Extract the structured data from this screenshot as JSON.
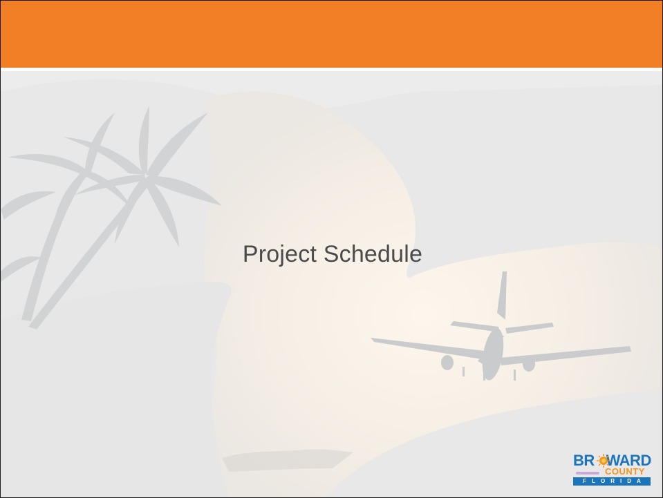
{
  "slide": {
    "title": "Project Schedule",
    "header_color": "#f27f26",
    "background_color": "#e8e8e8"
  },
  "logo": {
    "name": "Broward County Florida logo",
    "primary_color": "#1c75bc",
    "accent_color": "#f7941d",
    "text": "BROWARD COUNTY FLORIDA"
  },
  "background": {
    "scene": "palm-trees-and-airplane-sunset"
  }
}
